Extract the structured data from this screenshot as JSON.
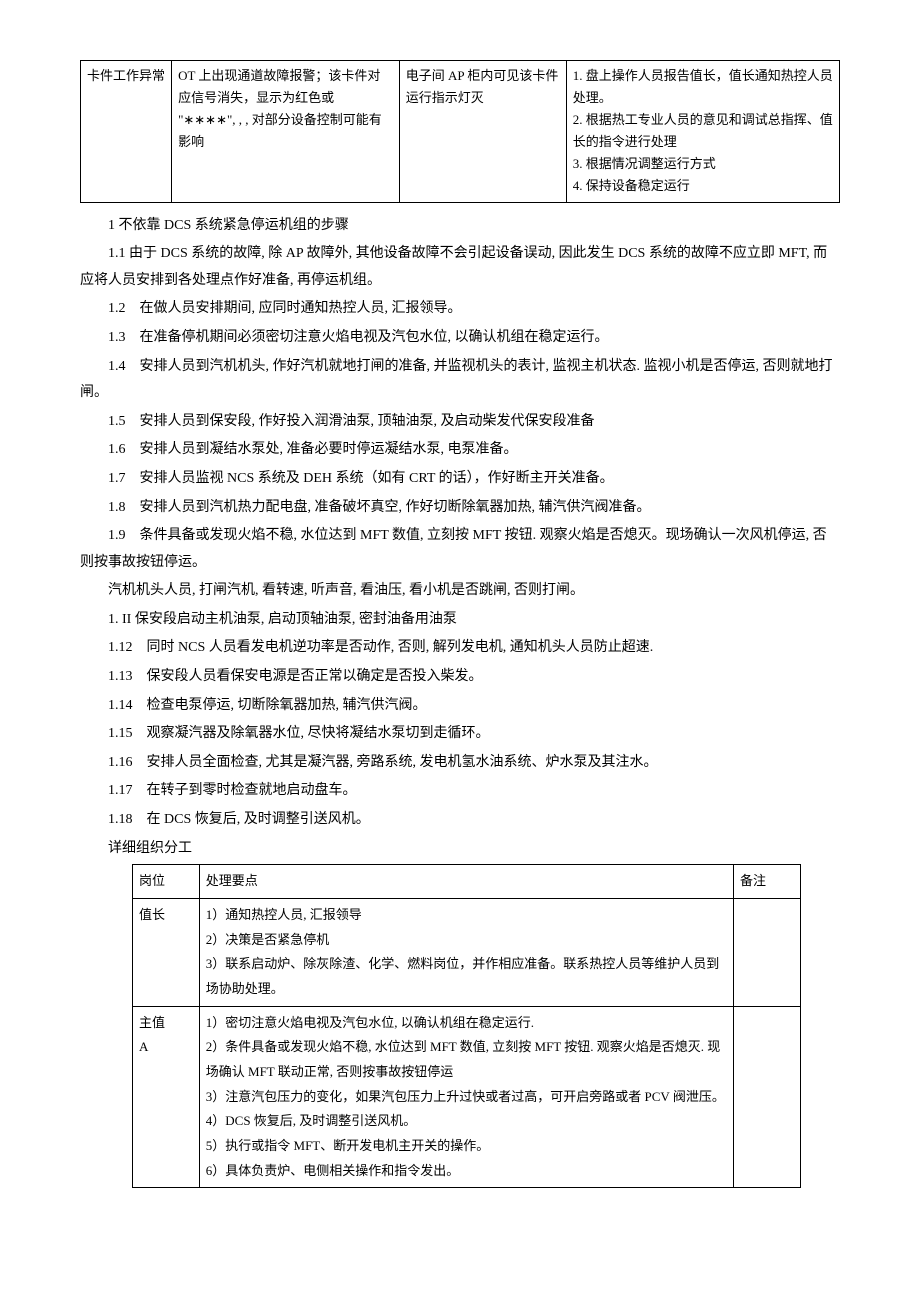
{
  "table1": {
    "r0c0": "卡件工作异常",
    "r0c1": "OT 上出现通道故障报警；该卡件对应信号消失，显示为红色或 \"∗∗∗∗\", , , 对部分设备控制可能有影响",
    "r0c2": "电子间 AP 柜内可见该卡件运行指示灯灭",
    "r0c3_l1": "1. 盘上操作人员报告值长，值长通知热控人员处理。",
    "r0c3_l2": "2. 根据热工专业人员的意见和调试总指挥、值长的指令进行处理",
    "r0c3_l3": "3. 根据情况调整运行方式",
    "r0c3_l4": "4. 保持设备稳定运行"
  },
  "h1": "1 不依靠 DCS 系统紧急停运机组的步骤",
  "p1_1": "1.1 由于 DCS 系统的故障, 除 AP 故障外, 其他设备故障不会引起设备误动, 因此发生 DCS 系统的故障不应立即 MFT, 而应将人员安排到各处理点作好准备, 再停运机组。",
  "p1_2": "1.2　在做人员安排期间, 应同时通知热控人员, 汇报领导。",
  "p1_3": "1.3　在准备停机期间必须密切注意火焰电视及汽包水位, 以确认机组在稳定运行。",
  "p1_4": "1.4　安排人员到汽机机头, 作好汽机就地打闸的准备, 并监视机头的表计, 监视主机状态. 监视小机是否停运, 否则就地打闸。",
  "p1_5": "1.5　安排人员到保安段, 作好投入润滑油泵, 顶轴油泵, 及启动柴发代保安段准备",
  "p1_6": "1.6　安排人员到凝结水泵处, 准备必要时停运凝结水泵, 电泵准备。",
  "p1_7": "1.7　安排人员监视 NCS 系统及 DEH 系统（如有 CRT 的话），作好断主开关准备。",
  "p1_8": "1.8　安排人员到汽机热力配电盘, 准备破坏真空, 作好切断除氧器加热, 辅汽供汽阀准备。",
  "p1_9": "1.9　条件具备或发现火焰不稳, 水位达到 MFT 数值, 立刻按 MFT 按钮. 观察火焰是否熄灭。现场确认一次风机停运, 否则按事故按钮停运。",
  "p_a": "汽机机头人员, 打闸汽机, 看转速, 听声音, 看油压, 看小机是否跳闸, 否则打闸。",
  "p_b": "1. II 保安段启动主机油泵, 启动顶轴油泵, 密封油备用油泵",
  "p1_12": "1.12　同时 NCS 人员看发电机逆功率是否动作, 否则, 解列发电机, 通知机头人员防止超速.",
  "p1_13": "1.13　保安段人员看保安电源是否正常以确定是否投入柴发。",
  "p1_14": "1.14　检查电泵停运, 切断除氧器加热, 辅汽供汽阀。",
  "p1_15": "1.15　观察凝汽器及除氧器水位, 尽快将凝结水泵切到走循环。",
  "p1_16": "1.16　安排人员全面检查, 尤其是凝汽器, 旁路系统, 发电机氢水油系统、炉水泵及其注水。",
  "p1_17": "1.17　在转子到零时检查就地启动盘车。",
  "p1_18": "1.18　在 DCS 恢复后, 及时调整引送风机。",
  "h2": "详细组织分工",
  "table2": {
    "hdr_c0": "岗位",
    "hdr_c1": "处理要点",
    "hdr_c2": "备注",
    "r1c0": "值长",
    "r1c1_l1": "1）通知热控人员, 汇报领导",
    "r1c1_l2": "2）决策是否紧急停机",
    "r1c1_l3": "3）联系启动炉、除灰除渣、化学、燃料岗位，并作相应准备。联系热控人员等维护人员到场协助处理。",
    "r2c0_l1": "主值",
    "r2c0_l2": "A",
    "r2c1_l1": "1）密切注意火焰电视及汽包水位, 以确认机组在稳定运行.",
    "r2c1_l2": "2）条件具备或发现火焰不稳, 水位达到 MFT 数值, 立刻按 MFT 按钮. 观察火焰是否熄灭. 现场确认 MFT 联动正常, 否则按事故按钮停运",
    "r2c1_l3": "3）注意汽包压力的变化，如果汽包压力上升过快或者过高，可开启旁路或者 PCV 阀泄压。",
    "r2c1_l4": "4）DCS 恢复后, 及时调整引送风机。",
    "r2c1_l5": "5）执行或指令 MFT、断开发电机主开关的操作。",
    "r2c1_l6": "6）具体负责炉、电侧相关操作和指令发出。"
  }
}
